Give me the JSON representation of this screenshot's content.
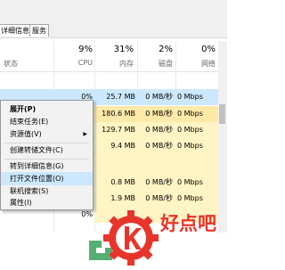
{
  "tabs": [
    "详细信息",
    "服务"
  ],
  "columns": [
    {
      "pct": "9%",
      "label": "CPU"
    },
    {
      "pct": "31%",
      "label": "内存"
    },
    {
      "pct": "2%",
      "label": "磁盘"
    },
    {
      "pct": "0%",
      "label": "网络"
    }
  ],
  "status_label": "状态",
  "rows": [
    {
      "cpu": "0%",
      "mem": "25.7 MB",
      "disk": "0 MB/秒",
      "net": "0 Mbps"
    },
    {
      "cpu": "0%",
      "mem": "180.6 MB",
      "disk": "0 MB/秒",
      "net": "0 Mbps"
    },
    {
      "cpu": "0%",
      "mem": "129.7 MB",
      "disk": "0 MB/秒",
      "net": "0 Mbps"
    },
    {
      "cpu": "0%",
      "mem": "9.4 MB",
      "disk": "0 MB/秒",
      "net": "0 Mbps"
    },
    {
      "cpu": "",
      "mem": "",
      "disk": "",
      "net": ""
    },
    {
      "cpu": "",
      "mem": "",
      "disk": "",
      "net": ""
    },
    {
      "cpu": "0%",
      "mem": "0.8 MB",
      "disk": "0 MB/秒",
      "net": "0 Mbps"
    },
    {
      "cpu": "0%",
      "mem": "1.9 MB",
      "disk": "0 MB/秒",
      "net": "0 Mbps"
    },
    {
      "cpu": "0%",
      "mem": "",
      "disk": "",
      "net": ""
    }
  ],
  "context_menu": [
    {
      "label": "展开(P)",
      "bold": true
    },
    {
      "label": "结束任务(E)"
    },
    {
      "label": "资源值(V)",
      "submenu": true
    },
    {
      "label": "创建转储文件(C)"
    },
    {
      "label": "转到详细信息(G)"
    },
    {
      "label": "打开文件位置(O)",
      "highlighted": true
    },
    {
      "label": "联机搜索(S)"
    },
    {
      "label": "属性(I)"
    }
  ],
  "watermark": {
    "text": "好点吧",
    "brand_red": "#e8352b",
    "brand_green": "#3aa05a"
  },
  "colors": {
    "selection": "#cce8ff",
    "heat_light": "#fff4c4",
    "heat_mid": "#ffe9a8"
  }
}
